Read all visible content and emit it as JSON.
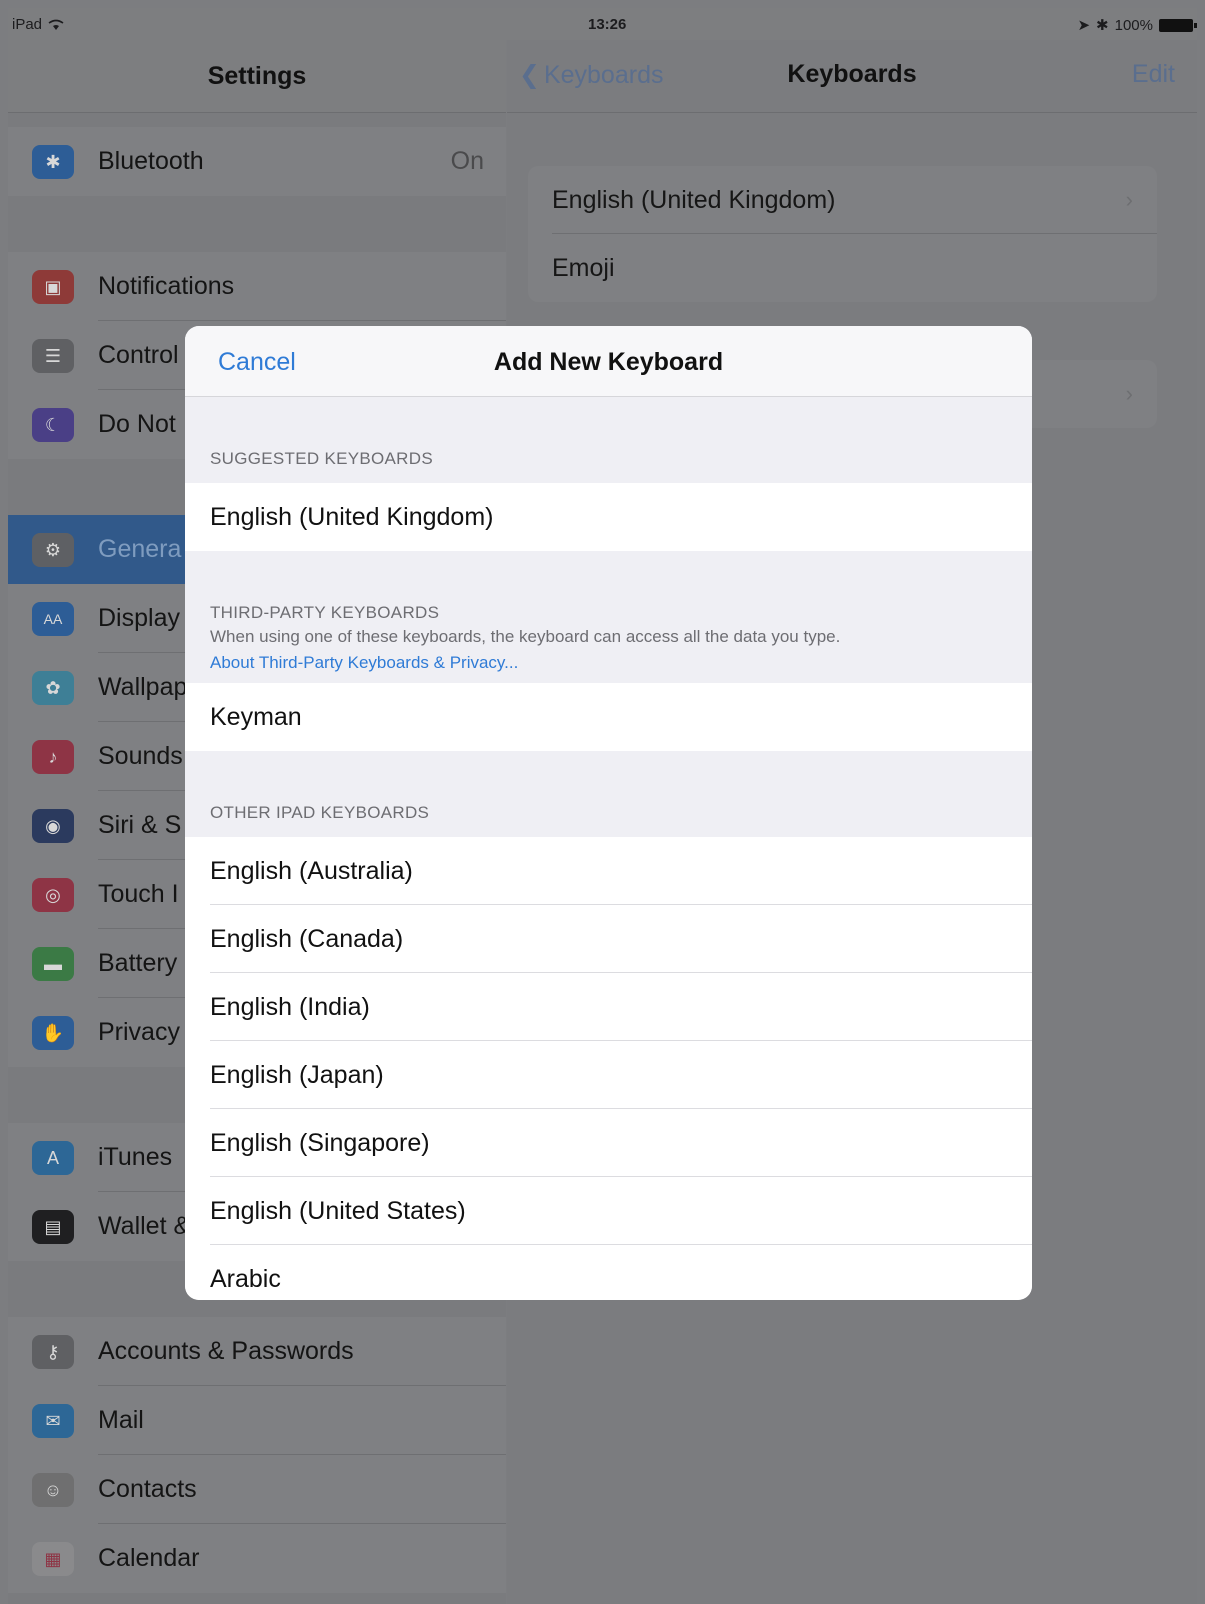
{
  "status_bar": {
    "device": "iPad",
    "time": "13:26",
    "battery": "100%"
  },
  "master": {
    "title": "Settings",
    "rows": [
      {
        "label": "Bluetooth",
        "value": "On"
      },
      {
        "label": "Notifications"
      },
      {
        "label": "Control"
      },
      {
        "label": "Do Not"
      },
      {
        "label": "Genera"
      },
      {
        "label": "Display"
      },
      {
        "label": "Wallpap"
      },
      {
        "label": "Sounds"
      },
      {
        "label": "Siri & S"
      },
      {
        "label": "Touch I"
      },
      {
        "label": "Battery"
      },
      {
        "label": "Privacy"
      },
      {
        "label": "iTunes"
      },
      {
        "label": "Wallet &"
      },
      {
        "label": "Accounts & Passwords"
      },
      {
        "label": "Mail"
      },
      {
        "label": "Contacts"
      },
      {
        "label": "Calendar"
      }
    ]
  },
  "detail": {
    "back_label": "Keyboards",
    "title": "Keyboards",
    "edit_label": "Edit",
    "keyboards": [
      "English (United Kingdom)",
      "Emoji"
    ]
  },
  "modal": {
    "cancel_label": "Cancel",
    "title": "Add New Keyboard",
    "suggested_header": "SUGGESTED KEYBOARDS",
    "suggested": [
      "English (United Kingdom)"
    ],
    "third_party_header": "THIRD-PARTY KEYBOARDS",
    "third_party_note": "When using one of these keyboards, the keyboard can access all the data you type.",
    "third_party_link": "About Third-Party Keyboards & Privacy...",
    "third_party": [
      "Keyman"
    ],
    "other_header": "OTHER IPAD KEYBOARDS",
    "other": [
      "English (Australia)",
      "English (Canada)",
      "English (India)",
      "English (Japan)",
      "English (Singapore)",
      "English (United States)",
      "Arabic"
    ]
  },
  "colors": {
    "accent_blue": "#2f7bd6",
    "dim_overlay": "#7c7d80"
  }
}
